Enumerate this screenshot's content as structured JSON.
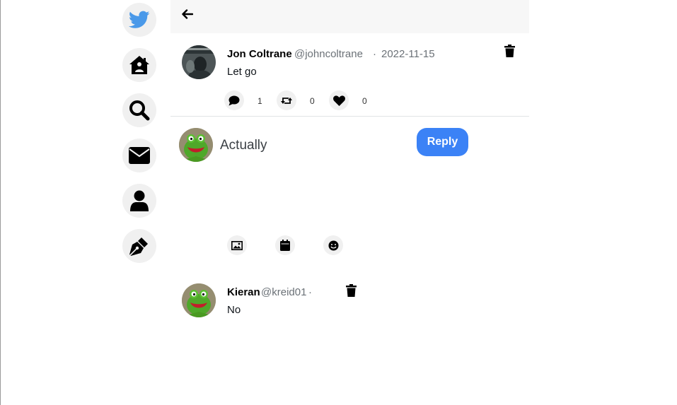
{
  "sidebar": {
    "items": [
      {
        "name": "twitter-logo",
        "icon": "twitter-bird-icon",
        "color": "#4a99e9"
      },
      {
        "name": "home",
        "icon": "home-icon"
      },
      {
        "name": "search",
        "icon": "search-icon"
      },
      {
        "name": "messages",
        "icon": "envelope-icon"
      },
      {
        "name": "profile",
        "icon": "user-icon"
      },
      {
        "name": "compose",
        "icon": "pen-nib-icon"
      }
    ]
  },
  "header": {
    "back_icon": "arrow-left-icon"
  },
  "tweet": {
    "author_name": "Jon Coltrane",
    "author_handle": "@johncoltrane",
    "separator": "·",
    "date": "2022-11-15",
    "text": "Let go",
    "replies": "1",
    "retweets": "0",
    "likes": "0"
  },
  "composer": {
    "value": "Actually",
    "reply_label": "Reply",
    "accent": "#3b82f6"
  },
  "replies": [
    {
      "author_name": "Kieran",
      "author_handle": "@kreid01",
      "separator": "·",
      "text": "No"
    }
  ]
}
